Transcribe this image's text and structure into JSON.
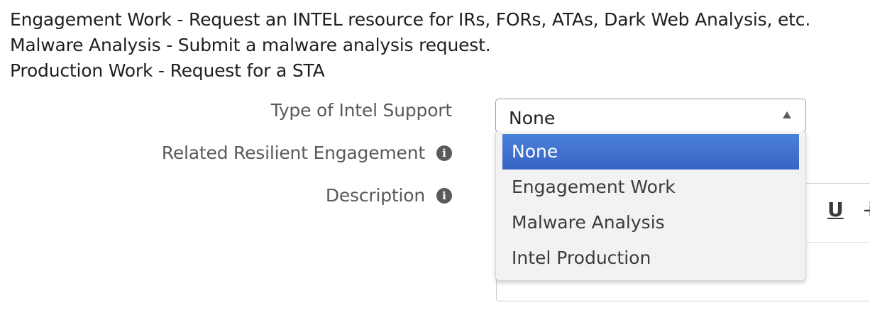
{
  "intro": {
    "line1": "Engagement Work - Request an INTEL resource for IRs, FORs, ATAs, Dark Web Analysis, etc.",
    "line2": "Malware Analysis - Submit a malware analysis request.",
    "line3": "Production Work - Request for a STA"
  },
  "fields": {
    "type_label": "Type of Intel Support",
    "related_label": "Related Resilient Engagement",
    "description_label": "Description"
  },
  "select": {
    "value": "None",
    "options": [
      "None",
      "Engagement Work",
      "Malware Analysis",
      "Intel Production"
    ]
  },
  "icons": {
    "info": "info-circle-icon",
    "caret": "caret-up-icon",
    "underline": "underline-icon",
    "strikethrough": "strikethrough-icon"
  },
  "editor": {
    "underline_glyph": "U"
  },
  "colors": {
    "selected_option": "#3f6fcf",
    "dropdown_bg": "#f2f2f2",
    "label_text": "#5a5a5a"
  }
}
